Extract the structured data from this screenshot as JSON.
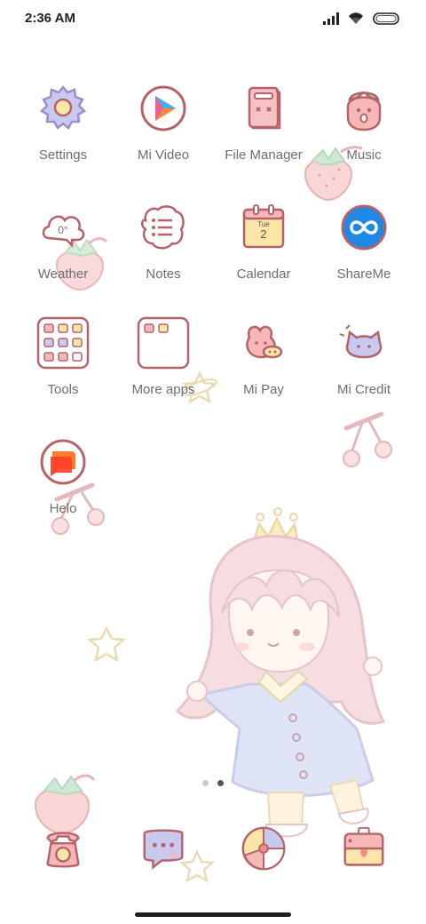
{
  "status_bar": {
    "time": "2:36 AM"
  },
  "apps": [
    {
      "label": "Settings",
      "icon": "gear-icon"
    },
    {
      "label": "Mi Video",
      "icon": "play-icon"
    },
    {
      "label": "File Manager",
      "icon": "folder-icon"
    },
    {
      "label": "Music",
      "icon": "music-icon"
    },
    {
      "label": "Weather",
      "icon": "cloud-icon"
    },
    {
      "label": "Notes",
      "icon": "notes-icon"
    },
    {
      "label": "Calendar",
      "icon": "calendar-icon",
      "day": "Tue",
      "date": "2"
    },
    {
      "label": "ShareMe",
      "icon": "infinity-icon"
    },
    {
      "label": "Tools",
      "icon": "tools-folder-icon"
    },
    {
      "label": "More apps",
      "icon": "apps-folder-icon"
    },
    {
      "label": "Mi Pay",
      "icon": "bunny-icon"
    },
    {
      "label": "Mi Credit",
      "icon": "cat-icon"
    },
    {
      "label": "Helo",
      "icon": "chat-bubble-icon"
    }
  ],
  "weather_temp": "0°",
  "dock": [
    {
      "name": "phone-dock-icon",
      "icon": "phone-icon"
    },
    {
      "name": "messages-dock-icon",
      "icon": "message-icon"
    },
    {
      "name": "browser-dock-icon",
      "icon": "ball-icon"
    },
    {
      "name": "camera-dock-icon",
      "icon": "camera-icon"
    }
  ],
  "page_indicator": {
    "pages": 2,
    "current": 2
  },
  "colors": {
    "icon_outline": "#b5636b",
    "icon_pink": "#f4c4c4",
    "icon_lilac": "#c9c8ee",
    "icon_yellow": "#fbe6a8",
    "shareme_blue": "#1e88e5",
    "helo_orange": "#ff5a2a"
  }
}
